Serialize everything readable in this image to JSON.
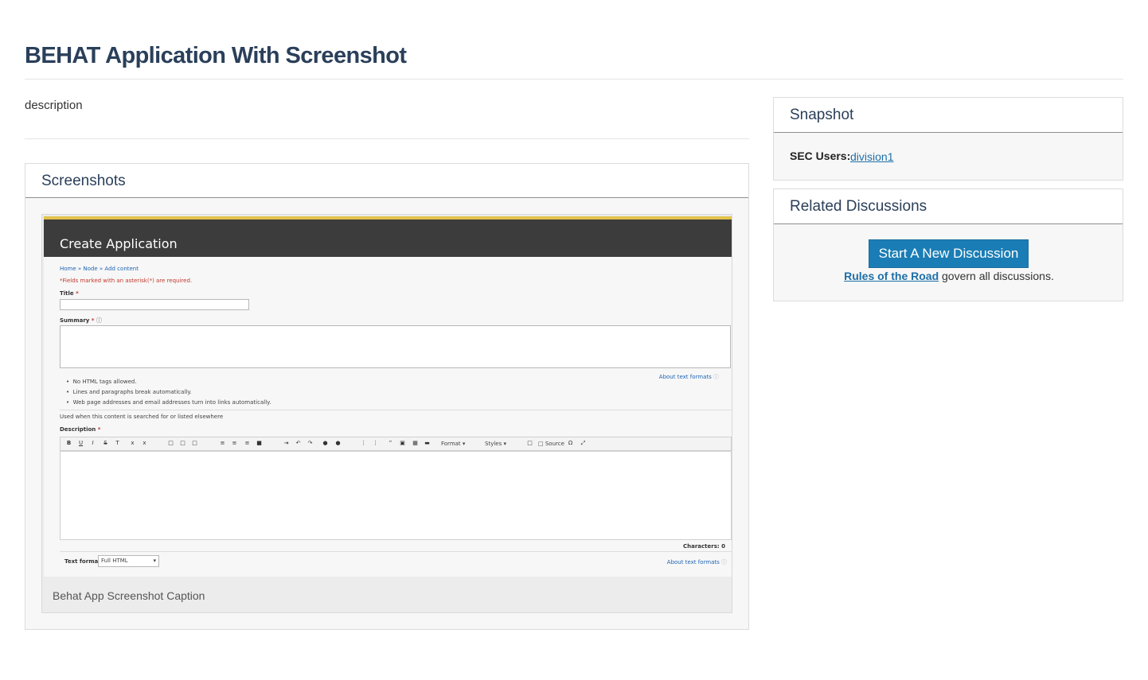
{
  "page": {
    "title": "BEHAT Application With Screenshot",
    "description": "description"
  },
  "screenshots": {
    "heading": "Screenshots",
    "caption": "Behat App Screenshot Caption",
    "image": {
      "title": "Create Application",
      "breadcrumb": "Home » Node » Add content",
      "required_note": "*Fields marked with an asterisk(*) are required.",
      "title_label": "Title",
      "summary_label": "Summary",
      "about_formats": "About text formats",
      "hints": [
        "No HTML tags allowed.",
        "Lines and paragraphs break automatically.",
        "Web page addresses and email addresses turn into links automatically."
      ],
      "used_when": "Used when this content is searched for or listed elsewhere",
      "description_label": "Description",
      "toolbar_format": "Format",
      "toolbar_styles": "Styles",
      "toolbar_source": "Source",
      "characters": "Characters: 0",
      "text_format_label": "Text format",
      "text_format_value": "Full HTML"
    }
  },
  "snapshot": {
    "heading": "Snapshot",
    "sec_users_label": "SEC Users:",
    "sec_users_value": "division1"
  },
  "discussions": {
    "heading": "Related Discussions",
    "button": "Start A New Discussion",
    "rules_link": "Rules of the Road",
    "rules_suffix": " govern all discussions."
  },
  "colors": {
    "title": "#2a3f5a",
    "link": "#1e6fa8",
    "button": "#1a7db5"
  }
}
